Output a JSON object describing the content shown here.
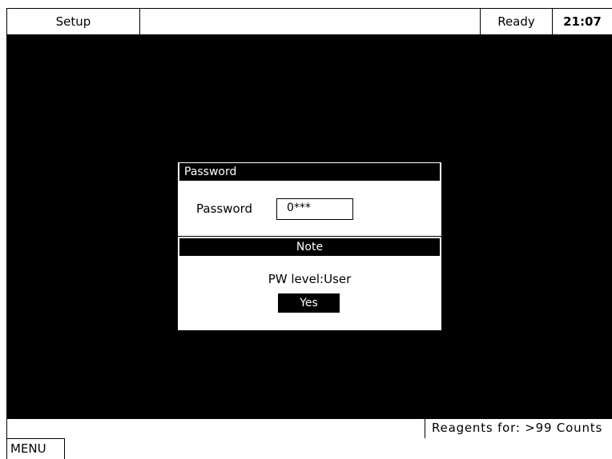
{
  "header": {
    "menu_title": "Setup",
    "status": "Ready",
    "clock": "21:07"
  },
  "password_dialog": {
    "title": "Password",
    "field_label": "Password",
    "field_value": "0***"
  },
  "note_dialog": {
    "title": "Note",
    "message": "PW level:User",
    "confirm_label": "Yes"
  },
  "footer": {
    "reagents_status": "Reagents for: >99 Counts",
    "menu_label": "MENU"
  },
  "colors": {
    "screen_background": "#000000",
    "panel_background": "#ffffff",
    "text": "#000000",
    "inverse_text": "#ffffff"
  }
}
